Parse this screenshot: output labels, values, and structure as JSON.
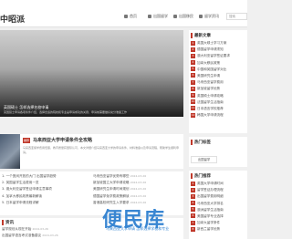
{
  "site": {
    "logo": "中昭派"
  },
  "nav": [
    {
      "label": "首页"
    },
    {
      "label": "出国留学"
    },
    {
      "label": "出国移民"
    },
    {
      "label": "留学资讯"
    }
  ],
  "search": {
    "placeholder": "搜索"
  },
  "slide": {
    "title": "英国硕士 怎样选择名校申请",
    "desc": "英国硕士申请各项条件介绍，选择合适的院校和专业是申请成功的关键，申请前需要做好充分准备工作"
  },
  "featured": {
    "badge": "推荐",
    "title": "马来西亚大学申请条件全攻略",
    "desc": "马来西亚留学费用低廉，教育质量获国际认可，本文详细介绍马来西亚大学的申请条件、材料准备以及申请流程，帮助学生顺利申请。"
  },
  "left_list": {
    "rows": [
      {
        "text": "1. 一个宽阔开放的大门 出国留学趋势",
        "date": "2024-03-26"
      },
      {
        "text": "2. 英国留学生活费用一览",
        "date": "2024-03-26"
      },
      {
        "text": "3. 澳大利亚留学签证申请注意事项",
        "date": "2024-03-26"
      },
      {
        "text": "4. 加拿大移民政策最新解读",
        "date": "2024-03-26"
      },
      {
        "text": "5. 日本留学申请流程详解",
        "date": "2024-03-26"
      }
    ]
  },
  "right_list": {
    "rows": [
      {
        "text": "马来西亚留学优势有哪些",
        "date": "2024-03-26"
      },
      {
        "text": "新加坡国立大学申请攻略",
        "date": "2024-03-26"
      },
      {
        "text": "美国研究生申请时间规划",
        "date": "2024-03-26"
      },
      {
        "text": "德国留学免学费政策解读",
        "date": "2024-03-26"
      },
      {
        "text": "香港高校研究生入学要求",
        "date": "2024-03-26"
      }
    ]
  },
  "bottom": {
    "title": "资讯",
    "rows": [
      {
        "text": "留学规划从现在开始",
        "date": "2024-03-26"
      },
      {
        "text": "出国留学语言考试准备建议",
        "date": "2024-03-26"
      }
    ]
  },
  "watermark": {
    "main": "便民库",
    "sub": "马来西亚大学申请 怎样选择学校和专业"
  },
  "side1": {
    "title": "最新文章",
    "items": [
      {
        "num": "1",
        "text": "英国大硕士学习方案"
      },
      {
        "num": "2",
        "text": "德国留学申请须知"
      },
      {
        "num": "3",
        "text": "澳大利亚留学签证要求"
      },
      {
        "num": "4",
        "text": "加拿大移民政策"
      },
      {
        "num": "5",
        "text": "中国和英国留学对比"
      },
      {
        "num": "6",
        "text": "美国研究生申请"
      },
      {
        "num": "7",
        "text": "马来西亚留学费用"
      },
      {
        "num": "8",
        "text": "新加坡留学优势"
      },
      {
        "num": "9",
        "text": "英国硕士申请攻略"
      },
      {
        "num": "10",
        "text": "法国留学生活指南"
      },
      {
        "num": "11",
        "text": "日本语言学校推荐"
      },
      {
        "num": "12",
        "text": "韩国大学申请流程"
      }
    ]
  },
  "side2": {
    "title": "热门标签",
    "tags": [
      "出国留学",
      "留学资讯",
      "出国移民",
      "留学费用"
    ]
  },
  "side3": {
    "title": "热门推荐",
    "items": [
      {
        "num": "1",
        "text": "英国大学申请时间"
      },
      {
        "num": "2",
        "text": "留学签证办理流程"
      },
      {
        "num": "3",
        "text": "出国留学费用明细"
      },
      {
        "num": "4",
        "text": "马来西亚大学排名"
      },
      {
        "num": "5",
        "text": "澳洲留学生活指南"
      },
      {
        "num": "6",
        "text": "美国留学专业选择"
      },
      {
        "num": "7",
        "text": "加拿大留学条件"
      },
      {
        "num": "8",
        "text": "新西兰留学优势"
      }
    ]
  },
  "colors": {
    "accent": "#c0392b",
    "watermark": "#2f80d0"
  }
}
